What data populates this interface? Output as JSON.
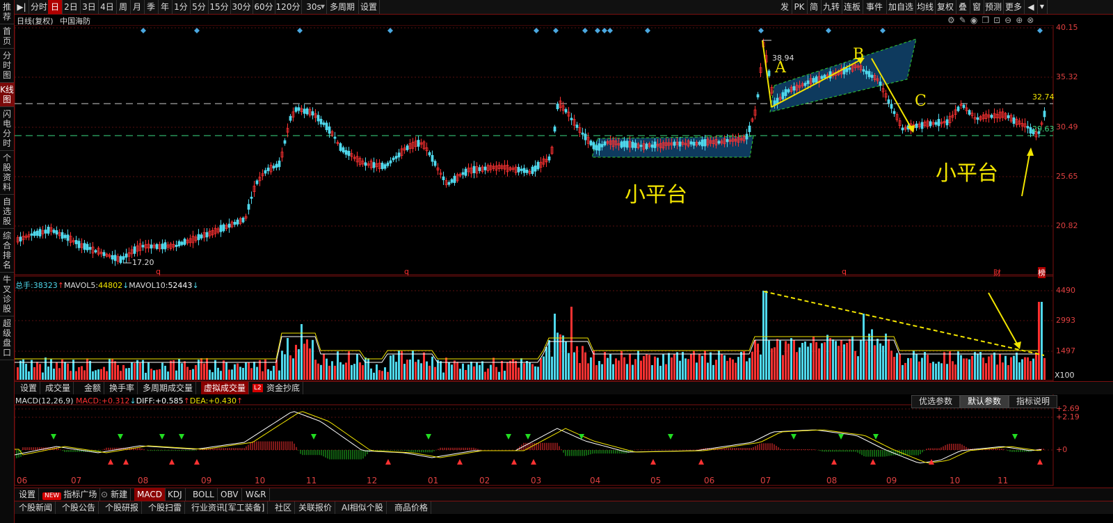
{
  "left_sidebar": [
    {
      "label": "推荐"
    },
    {
      "label": "首页"
    },
    {
      "label": "分时图"
    },
    {
      "label": "K线图",
      "active": true
    },
    {
      "label": "闪电分时"
    },
    {
      "label": "个股资料"
    },
    {
      "label": "自选股"
    },
    {
      "label": "综合排名"
    },
    {
      "label": "牛叉诊股"
    },
    {
      "label": "超级盘口"
    }
  ],
  "toolbar": {
    "left": [
      "分时",
      "日",
      "2日",
      "3日",
      "4日",
      "周",
      "月",
      "季",
      "年",
      "1分",
      "5分",
      "15分",
      "30分",
      "60分",
      "120分",
      "30s",
      "多周期",
      "设置"
    ],
    "active": "日",
    "right": [
      "发",
      "PK",
      "简",
      "九转",
      "连板",
      "事件",
      "加自选",
      "均线",
      "复权",
      "叠",
      "窗",
      "预测",
      "更多"
    ]
  },
  "chart": {
    "title": "日线(复权)",
    "stock_name": "中国海防",
    "price_axis": [
      "40.15",
      "35.32",
      "30.49",
      "25.65",
      "20.82"
    ],
    "current_price": "32.74",
    "support_price": "29.63",
    "high_label": "38.94",
    "low_label": "17.20",
    "markers": [
      "q",
      "q",
      "q",
      "财",
      "榜"
    ]
  },
  "annotations": {
    "platform1": "小平台",
    "platform2": "小平台",
    "A": "A",
    "B": "B",
    "C": "C"
  },
  "volume": {
    "label_total": "总手:",
    "total": "38323",
    "label_ma5": "MAVOL5:",
    "ma5": "44802",
    "label_ma10": "MAVOL10:",
    "ma10": "52443",
    "axis": [
      "4490",
      "2993",
      "1497"
    ],
    "unit": "X100"
  },
  "mid_tabs": [
    "设置",
    "成交量",
    "金额",
    "换手率",
    "多周期成交量",
    "虚拟成交量",
    "资金抄底"
  ],
  "mid_tabs_active": "虚拟成交量",
  "mid_badge": "L2",
  "macd": {
    "name": "MACD(12,26,9)",
    "label_macd": "MACD:",
    "macd": "+0.312",
    "label_diff": "DIFF:",
    "diff": "+0.585",
    "label_dea": "DEA:",
    "dea": "+0.430",
    "axis": [
      "+2.69",
      "+2.19",
      "+0"
    ],
    "buttons": [
      "优选参数",
      "默认参数",
      "指标说明"
    ],
    "buttons_active": "默认参数"
  },
  "months": [
    "06",
    "07",
    "08",
    "09",
    "10",
    "11",
    "12",
    "01",
    "02",
    "03",
    "04",
    "05",
    "06",
    "07",
    "08",
    "09",
    "10",
    "11"
  ],
  "indicator_tabs": [
    "设置",
    "指标广场",
    "新建",
    "MACD",
    "KDJ",
    "BOLL",
    "OBV",
    "W&R"
  ],
  "indicator_new_badge": "NEW",
  "indicator_active": "MACD",
  "bottom_tabs": [
    "个股新闻",
    "个股公告",
    "个股研报",
    "个股扫雷",
    "行业资讯[军工装备]",
    "社区",
    "关联报价",
    "AI相似个股",
    "商品价格"
  ],
  "colors": {
    "up": "#ff3232",
    "down": "#4fd8ec",
    "bg": "#000000",
    "accent": "#b00000",
    "annotation": "#f2e500",
    "channel": "#0e3a5e"
  }
}
